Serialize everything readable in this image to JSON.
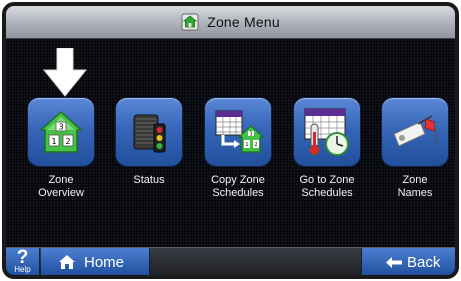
{
  "header": {
    "title": "Zone Menu",
    "icon": "home-icon"
  },
  "tiles": [
    {
      "label_line1": "Zone",
      "label_line2": "Overview",
      "icon": "zone-overview-icon",
      "selected": true
    },
    {
      "label_line1": "Status",
      "label_line2": "",
      "icon": "status-icon"
    },
    {
      "label_line1": "Copy Zone",
      "label_line2": "Schedules",
      "icon": "copy-zone-schedules-icon"
    },
    {
      "label_line1": "Go to Zone",
      "label_line2": "Schedules",
      "icon": "zone-schedules-icon"
    },
    {
      "label_line1": "Zone",
      "label_line2": "Names",
      "icon": "zone-names-icon"
    }
  ],
  "footer": {
    "help_symbol": "?",
    "help_label": "Help",
    "home_label": "Home",
    "back_label": "Back"
  },
  "colors": {
    "button_blue": "#3766b8",
    "screen_bg": "#05070d",
    "house_green": "#3fbf3f"
  }
}
